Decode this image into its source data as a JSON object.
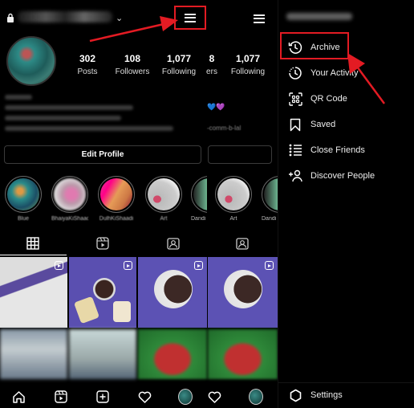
{
  "profile": {
    "stats": [
      {
        "value": "302",
        "label": "Posts"
      },
      {
        "value": "108",
        "label": "Followers"
      },
      {
        "value": "1,077",
        "label": "Following"
      }
    ],
    "stats_overlap": {
      "partial_value": "8",
      "partial_label": "ers",
      "following_value": "1,077",
      "following_label": "Following"
    },
    "bio_hearts": [
      "💙",
      "💜"
    ],
    "bio_link_partial": "-comm-b-lal",
    "edit_profile_label": "Edit Profile"
  },
  "highlights": [
    {
      "caption": "Blue"
    },
    {
      "caption": "BhaiyaKiShaadi"
    },
    {
      "caption": "DulhKiShaadi"
    },
    {
      "caption": "Art"
    },
    {
      "caption": "Dandi"
    },
    {
      "caption": "Art"
    },
    {
      "caption": "Dandi"
    }
  ],
  "profile_tabs": [
    {
      "name": "grid",
      "icon": "grid-icon",
      "active": true
    },
    {
      "name": "reels",
      "icon": "reels-icon",
      "active": false
    },
    {
      "name": "tagged",
      "icon": "tagged-icon",
      "active": false
    },
    {
      "name": "tagged-duplicate",
      "icon": "tagged-icon",
      "active": false
    }
  ],
  "bottom_nav": [
    {
      "icon": "home-icon"
    },
    {
      "icon": "reels-icon"
    },
    {
      "icon": "new-post-icon"
    },
    {
      "icon": "activity-heart-icon"
    },
    {
      "icon": "profile-avatar"
    },
    {
      "icon": "activity-heart-icon"
    },
    {
      "icon": "profile-avatar"
    }
  ],
  "drawer": {
    "menu_items": [
      {
        "label": "Archive",
        "icon": "archive-icon",
        "highlighted": true
      },
      {
        "label": "Your Activity",
        "icon": "activity-icon"
      },
      {
        "label": "QR Code",
        "icon": "qr-code-icon"
      },
      {
        "label": "Saved",
        "icon": "bookmark-icon"
      },
      {
        "label": "Close Friends",
        "icon": "close-friends-icon"
      },
      {
        "label": "Discover People",
        "icon": "add-person-icon"
      }
    ],
    "settings_label": "Settings"
  },
  "colors": {
    "background": "#000000",
    "annotation_red": "#e31b23",
    "text": "#ffffff"
  }
}
